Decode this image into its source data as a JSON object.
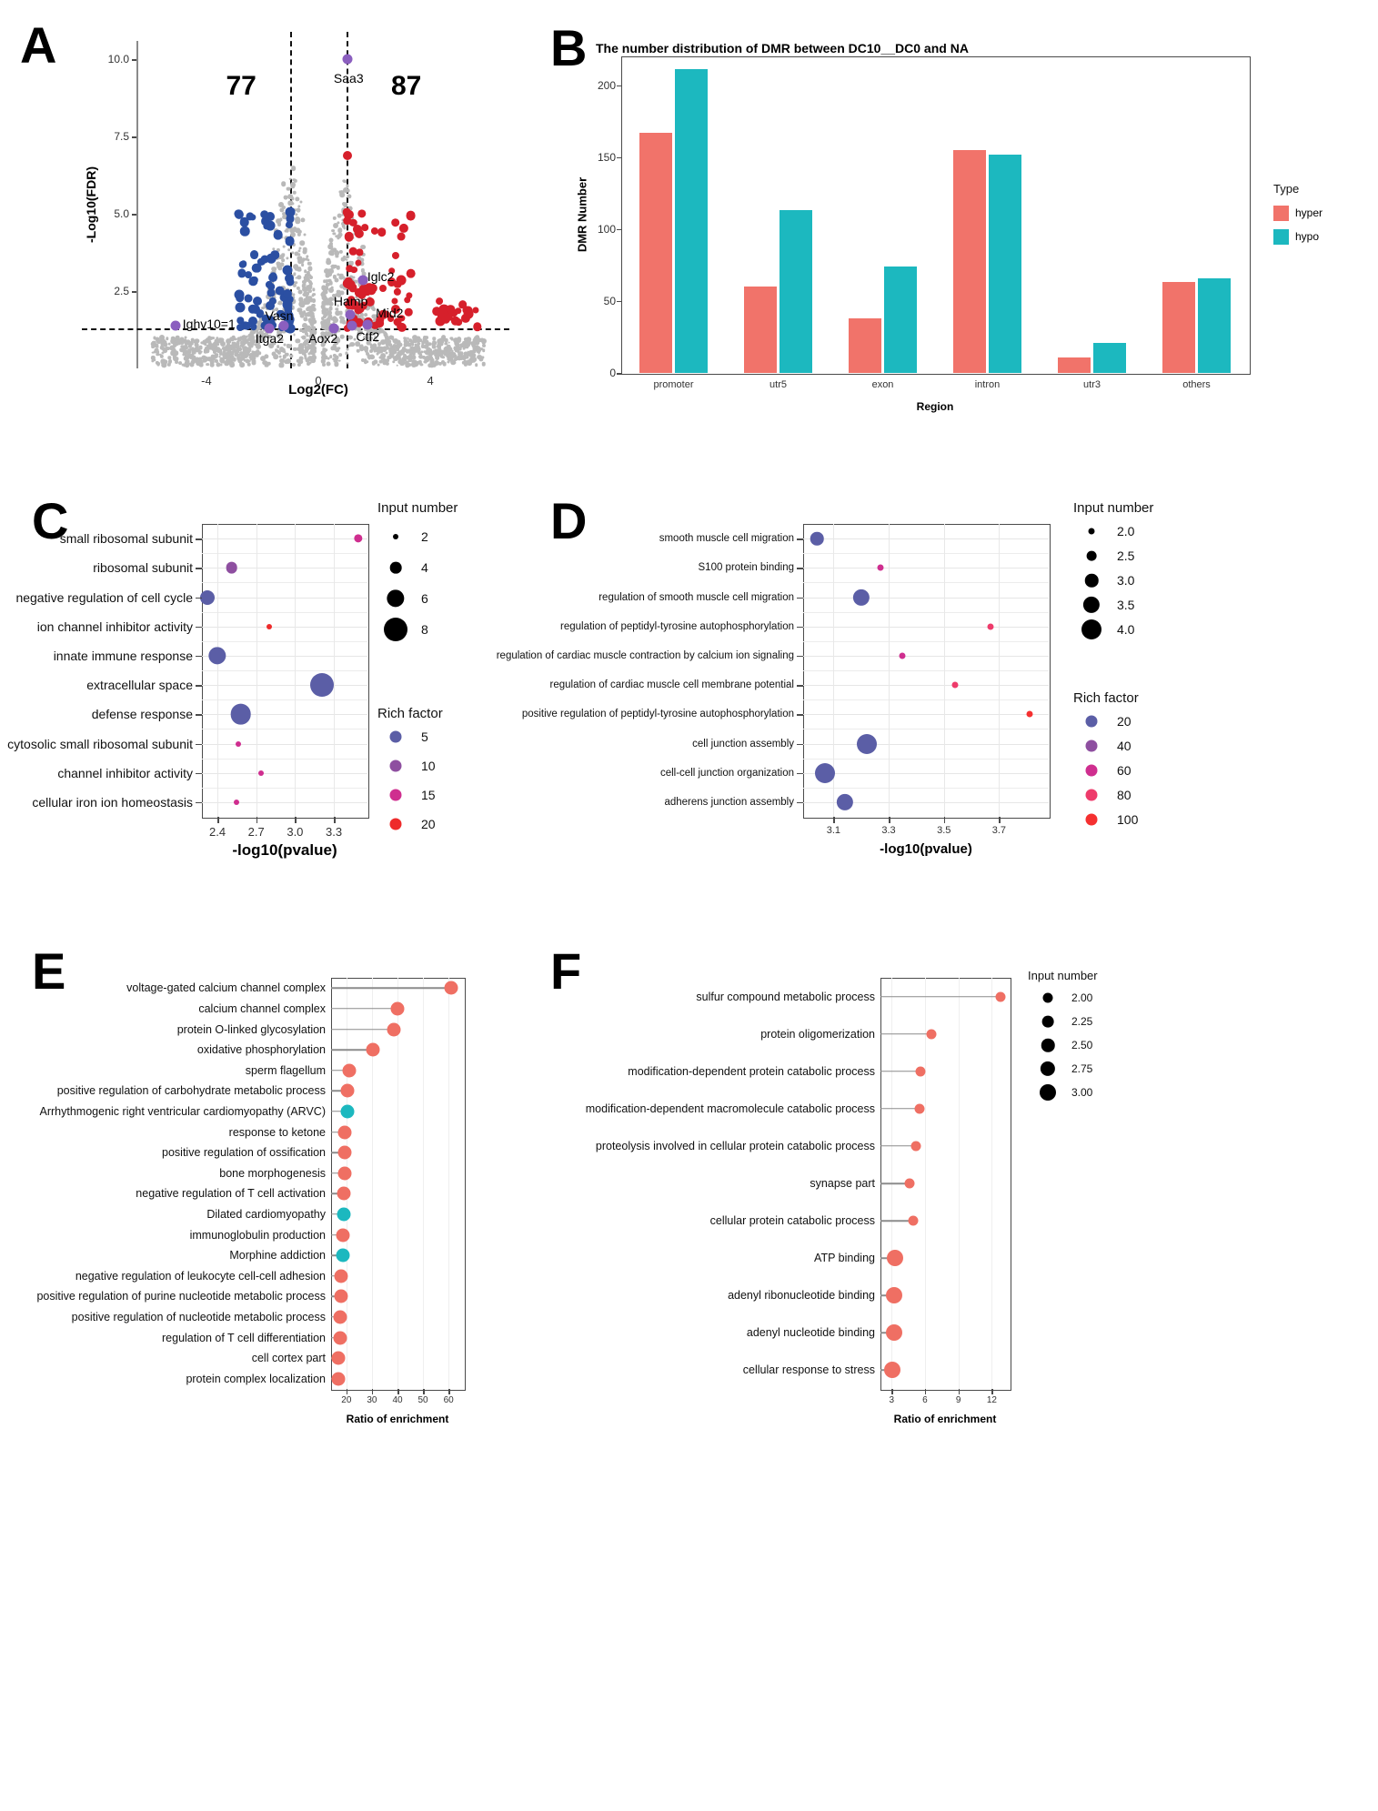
{
  "figure": {
    "panels": [
      "A",
      "B",
      "C",
      "D",
      "E",
      "F"
    ]
  },
  "panelA": {
    "label": "A",
    "xlabel": "Log2(FC)",
    "ylabel": "-Log10(FDR)",
    "xticks": [
      "-4",
      "0",
      "4"
    ],
    "yticks": [
      "2.5",
      "5.0",
      "7.5",
      "10.0"
    ],
    "count_down": "77",
    "count_up": "87",
    "gene_labels": [
      "Saa3",
      "Iglc2",
      "Hamp",
      "Mid2",
      "Ighv10=1",
      "Vasn",
      "Itga2",
      "Aox2",
      "Ctf2"
    ],
    "colors": {
      "up": "#d6202b",
      "down": "#2b4fa2",
      "ns": "#b9b9b9",
      "highlight": "#8b5fbf"
    }
  },
  "panelB": {
    "label": "B",
    "title": "The number distribution of DMR between DC10__DC0 and NA",
    "xlabel": "Region",
    "ylabel": "DMR Number",
    "legend_title": "Type",
    "colors": {
      "hyper": "#f1736a",
      "hypo": "#1cb8bf"
    }
  },
  "panelC": {
    "label": "C",
    "xlabel": "-log10(pvalue)",
    "size_legend_title": "Input number",
    "color_legend_title": "Rich factor"
  },
  "panelD": {
    "label": "D",
    "xlabel": "-log10(pvalue)",
    "size_legend_title": "Input number",
    "color_legend_title": "Rich factor"
  },
  "panelE": {
    "label": "E",
    "xlabel": "Ratio of enrichment",
    "colors": {
      "go": "#ef6f63",
      "kegg": "#1cb8bf"
    }
  },
  "panelF": {
    "label": "F",
    "xlabel": "Ratio of enrichment",
    "size_legend_title": "Input number",
    "colors": {
      "go": "#ef6f63"
    }
  },
  "chart_data": [
    {
      "panel": "A",
      "type": "scatter",
      "title": "",
      "xlabel": "Log2(FC)",
      "ylabel": "-Log10(FDR)",
      "xlim": [
        -6.5,
        6.5
      ],
      "ylim": [
        0,
        10.6
      ],
      "xticks": [
        -4,
        0,
        4
      ],
      "yticks": [
        2.5,
        5.0,
        7.5,
        10.0
      ],
      "thresholds": {
        "log2fc": [
          -1,
          1
        ],
        "fdr_line": 1.3
      },
      "annotations": [
        {
          "label": "77",
          "x": -2.8,
          "y": 9.2
        },
        {
          "label": "87",
          "x": 2.9,
          "y": 9.2
        },
        {
          "label": "Saa3",
          "x": 1.0,
          "y": 9.4
        },
        {
          "label": "Iglc2",
          "x": 1.9,
          "y": 2.9
        },
        {
          "label": "Hamp",
          "x": 1.3,
          "y": 2.1
        },
        {
          "label": "Mid2",
          "x": 2.5,
          "y": 1.75
        },
        {
          "label": "Ighv10=1",
          "x": -5.1,
          "y": 1.38
        },
        {
          "label": "Vasn",
          "x": -1.4,
          "y": 1.65
        },
        {
          "label": "Itga2",
          "x": -1.8,
          "y": 1.05
        },
        {
          "label": "Aox2",
          "x": 0.3,
          "y": 1.05
        },
        {
          "label": "Ctf2",
          "x": 1.8,
          "y": 1.1
        }
      ],
      "grid": false,
      "legend": "none"
    },
    {
      "panel": "B",
      "type": "bar",
      "title": "The number distribution of DMR between DC10__DC0 and NA",
      "xlabel": "Region",
      "ylabel": "DMR Number",
      "categories": [
        "promoter",
        "utr5",
        "exon",
        "intron",
        "utr3",
        "others"
      ],
      "series": [
        {
          "name": "hyper",
          "color": "#f1736a",
          "values": [
            167,
            60,
            38,
            155,
            11,
            63
          ]
        },
        {
          "name": "hypo",
          "color": "#1cb8bf",
          "values": [
            211,
            113,
            74,
            152,
            21,
            66
          ]
        }
      ],
      "yticks": [
        0,
        50,
        100,
        150,
        200
      ],
      "ylim": [
        0,
        220
      ],
      "legend_title": "Type",
      "legend_position": "right",
      "grid": false
    },
    {
      "panel": "C",
      "type": "scatter",
      "title": "",
      "xlabel": "-log10(pvalue)",
      "ylabel": "",
      "xticks": [
        2.4,
        2.7,
        3.0,
        3.3
      ],
      "xlim": [
        2.28,
        3.56
      ],
      "categories": [
        "small ribosomal subunit",
        "ribosomal subunit",
        "negative regulation of cell cycle",
        "ion channel inhibitor activity",
        "innate immune response",
        "extracellular space",
        "defense response",
        "cytosolic small ribosomal subunit",
        "channel inhibitor activity",
        "cellular iron ion homeostasis"
      ],
      "points": [
        {
          "term": "small ribosomal subunit",
          "pvalue": 3.49,
          "input_number": 3,
          "rich_factor": 15.5
        },
        {
          "term": "ribosomal subunit",
          "pvalue": 2.51,
          "input_number": 4,
          "rich_factor": 10.0
        },
        {
          "term": "negative regulation of cell cycle",
          "pvalue": 2.32,
          "input_number": 5,
          "rich_factor": 5.0
        },
        {
          "term": "ion channel inhibitor activity",
          "pvalue": 2.8,
          "input_number": 2,
          "rich_factor": 20.0
        },
        {
          "term": "innate immune response",
          "pvalue": 2.4,
          "input_number": 6,
          "rich_factor": 5.0
        },
        {
          "term": "extracellular space",
          "pvalue": 3.21,
          "input_number": 8,
          "rich_factor": 5.0
        },
        {
          "term": "defense response",
          "pvalue": 2.58,
          "input_number": 7,
          "rich_factor": 5.0
        },
        {
          "term": "cytosolic small ribosomal subunit",
          "pvalue": 2.56,
          "input_number": 2,
          "rich_factor": 15.0
        },
        {
          "term": "channel inhibitor activity",
          "pvalue": 2.74,
          "input_number": 2,
          "rich_factor": 16.0
        },
        {
          "term": "cellular iron ion homeostasis",
          "pvalue": 2.55,
          "input_number": 2,
          "rich_factor": 15.0
        }
      ],
      "size_legend": {
        "title": "Input number",
        "values": [
          2,
          4,
          6,
          8
        ]
      },
      "color_legend": {
        "title": "Rich factor",
        "values": [
          5,
          10,
          15,
          20
        ],
        "colors": [
          "#5b5ea6",
          "#8e4fa0",
          "#cf2e8f",
          "#ee2b2b"
        ]
      },
      "grid": true
    },
    {
      "panel": "D",
      "type": "scatter",
      "title": "",
      "xlabel": "-log10(pvalue)",
      "ylabel": "",
      "xticks": [
        3.1,
        3.3,
        3.5,
        3.7
      ],
      "xlim": [
        2.99,
        3.88
      ],
      "categories": [
        "smooth muscle cell migration",
        "S100 protein binding",
        "regulation of smooth muscle cell migration",
        "regulation of peptidyl-tyrosine autophosphorylation",
        "regulation of cardiac muscle contraction by calcium ion signaling",
        "regulation of cardiac muscle cell membrane potential",
        "positive regulation of peptidyl-tyrosine autophosphorylation",
        "cell junction assembly",
        "cell-cell junction organization",
        "adherens junction assembly"
      ],
      "points": [
        {
          "term": "smooth muscle cell migration",
          "pvalue": 3.04,
          "input_number": 3.0,
          "rich_factor": 20
        },
        {
          "term": "S100 protein binding",
          "pvalue": 3.27,
          "input_number": 2.0,
          "rich_factor": 60
        },
        {
          "term": "regulation of smooth muscle cell migration",
          "pvalue": 3.2,
          "input_number": 3.5,
          "rich_factor": 20
        },
        {
          "term": "regulation of peptidyl-tyrosine autophosphorylation",
          "pvalue": 3.67,
          "input_number": 2.0,
          "rich_factor": 80
        },
        {
          "term": "regulation of cardiac muscle contraction by calcium ion signaling",
          "pvalue": 3.35,
          "input_number": 2.0,
          "rich_factor": 60
        },
        {
          "term": "regulation of cardiac muscle cell membrane potential",
          "pvalue": 3.54,
          "input_number": 2.0,
          "rich_factor": 80
        },
        {
          "term": "positive regulation of peptidyl-tyrosine autophosphorylation",
          "pvalue": 3.81,
          "input_number": 2.0,
          "rich_factor": 100
        },
        {
          "term": "cell junction assembly",
          "pvalue": 3.22,
          "input_number": 4.0,
          "rich_factor": 20
        },
        {
          "term": "cell-cell junction organization",
          "pvalue": 3.07,
          "input_number": 4.0,
          "rich_factor": 20
        },
        {
          "term": "adherens junction assembly",
          "pvalue": 3.14,
          "input_number": 3.5,
          "rich_factor": 20
        }
      ],
      "size_legend": {
        "title": "Input number",
        "values": [
          2.0,
          2.5,
          3.0,
          3.5,
          4.0
        ]
      },
      "color_legend": {
        "title": "Rich factor",
        "values": [
          20,
          40,
          60,
          80,
          100
        ],
        "colors": [
          "#5b5ea6",
          "#8e4fa0",
          "#cf2e8f",
          "#ee3b6b",
          "#f53030"
        ]
      },
      "grid": true
    },
    {
      "panel": "E",
      "type": "scatter",
      "title": "",
      "xlabel": "Ratio of enrichment",
      "ylabel": "",
      "xticks": [
        20,
        30,
        40,
        50,
        60
      ],
      "xlim": [
        14,
        66
      ],
      "categories": [
        "voltage-gated calcium channel complex",
        "calcium channel complex",
        "protein O-linked glycosylation",
        "oxidative phosphorylation",
        "sperm flagellum",
        "positive regulation of carbohydrate metabolic process",
        "Arrhythmogenic right ventricular cardiomyopathy (ARVC)",
        "response to ketone",
        "positive regulation of ossification",
        "bone morphogenesis",
        "negative regulation of T cell activation",
        "Dilated cardiomyopathy",
        "immunoglobulin production",
        "Morphine addiction",
        "negative regulation of leukocyte cell-cell adhesion",
        "positive regulation of purine nucleotide metabolic process",
        "positive regulation of nucleotide metabolic process",
        "regulation of T cell differentiation",
        "cell cortex part",
        "protein complex localization"
      ],
      "points": [
        {
          "term": "voltage-gated calcium channel complex",
          "ratio": 61.0,
          "type": "go"
        },
        {
          "term": "calcium channel complex",
          "ratio": 40.0,
          "type": "go"
        },
        {
          "term": "protein O-linked glycosylation",
          "ratio": 38.5,
          "type": "go"
        },
        {
          "term": "oxidative phosphorylation",
          "ratio": 30.5,
          "type": "go"
        },
        {
          "term": "sperm flagellum",
          "ratio": 21.0,
          "type": "go"
        },
        {
          "term": "positive regulation of carbohydrate metabolic process",
          "ratio": 20.5,
          "type": "go"
        },
        {
          "term": "Arrhythmogenic right ventricular cardiomyopathy (ARVC)",
          "ratio": 20.5,
          "type": "kegg"
        },
        {
          "term": "response to ketone",
          "ratio": 19.5,
          "type": "go"
        },
        {
          "term": "positive regulation of ossification",
          "ratio": 19.5,
          "type": "go"
        },
        {
          "term": "bone morphogenesis",
          "ratio": 19.5,
          "type": "go"
        },
        {
          "term": "negative regulation of T cell activation",
          "ratio": 19.0,
          "type": "go"
        },
        {
          "term": "Dilated cardiomyopathy",
          "ratio": 19.0,
          "type": "kegg"
        },
        {
          "term": "immunoglobulin production",
          "ratio": 18.5,
          "type": "go"
        },
        {
          "term": "Morphine addiction",
          "ratio": 18.5,
          "type": "kegg"
        },
        {
          "term": "negative regulation of leukocyte cell-cell adhesion",
          "ratio": 18.0,
          "type": "go"
        },
        {
          "term": "positive regulation of purine nucleotide metabolic process",
          "ratio": 18.0,
          "type": "go"
        },
        {
          "term": "positive regulation of nucleotide metabolic process",
          "ratio": 17.5,
          "type": "go"
        },
        {
          "term": "regulation of T cell differentiation",
          "ratio": 17.5,
          "type": "go"
        },
        {
          "term": "cell cortex part",
          "ratio": 17.0,
          "type": "go"
        },
        {
          "term": "protein complex localization",
          "ratio": 17.0,
          "type": "go"
        }
      ],
      "grid": true
    },
    {
      "panel": "F",
      "type": "scatter",
      "title": "",
      "xlabel": "Ratio of enrichment",
      "ylabel": "",
      "xticks": [
        3,
        6,
        9,
        12
      ],
      "xlim": [
        2.0,
        13.6
      ],
      "categories": [
        "sulfur compound metabolic process",
        "protein oligomerization",
        "modification-dependent protein catabolic process",
        "modification-dependent macromolecule catabolic process",
        "proteolysis involved in cellular protein catabolic process",
        "synapse part",
        "cellular protein catabolic process",
        "ATP binding",
        "adenyl ribonucleotide binding",
        "adenyl nucleotide binding",
        "cellular response to stress"
      ],
      "points": [
        {
          "term": "sulfur compound metabolic process",
          "ratio": 12.8,
          "input_number": 2.0
        },
        {
          "term": "protein oligomerization",
          "ratio": 6.6,
          "input_number": 2.0
        },
        {
          "term": "modification-dependent protein catabolic process",
          "ratio": 5.6,
          "input_number": 2.0
        },
        {
          "term": "modification-dependent macromolecule catabolic process",
          "ratio": 5.5,
          "input_number": 2.0
        },
        {
          "term": "proteolysis involved in cellular protein catabolic process",
          "ratio": 5.2,
          "input_number": 2.0
        },
        {
          "term": "synapse part",
          "ratio": 4.6,
          "input_number": 2.0
        },
        {
          "term": "cellular protein catabolic process",
          "ratio": 4.9,
          "input_number": 2.0
        },
        {
          "term": "ATP binding",
          "ratio": 3.3,
          "input_number": 3.0
        },
        {
          "term": "adenyl ribonucleotide binding",
          "ratio": 3.2,
          "input_number": 3.0
        },
        {
          "term": "adenyl nucleotide binding",
          "ratio": 3.2,
          "input_number": 3.0
        },
        {
          "term": "cellular response to stress",
          "ratio": 3.1,
          "input_number": 3.0
        }
      ],
      "size_legend": {
        "title": "Input number",
        "values": [
          2.0,
          2.25,
          2.5,
          2.75,
          3.0
        ]
      },
      "grid": true
    }
  ]
}
